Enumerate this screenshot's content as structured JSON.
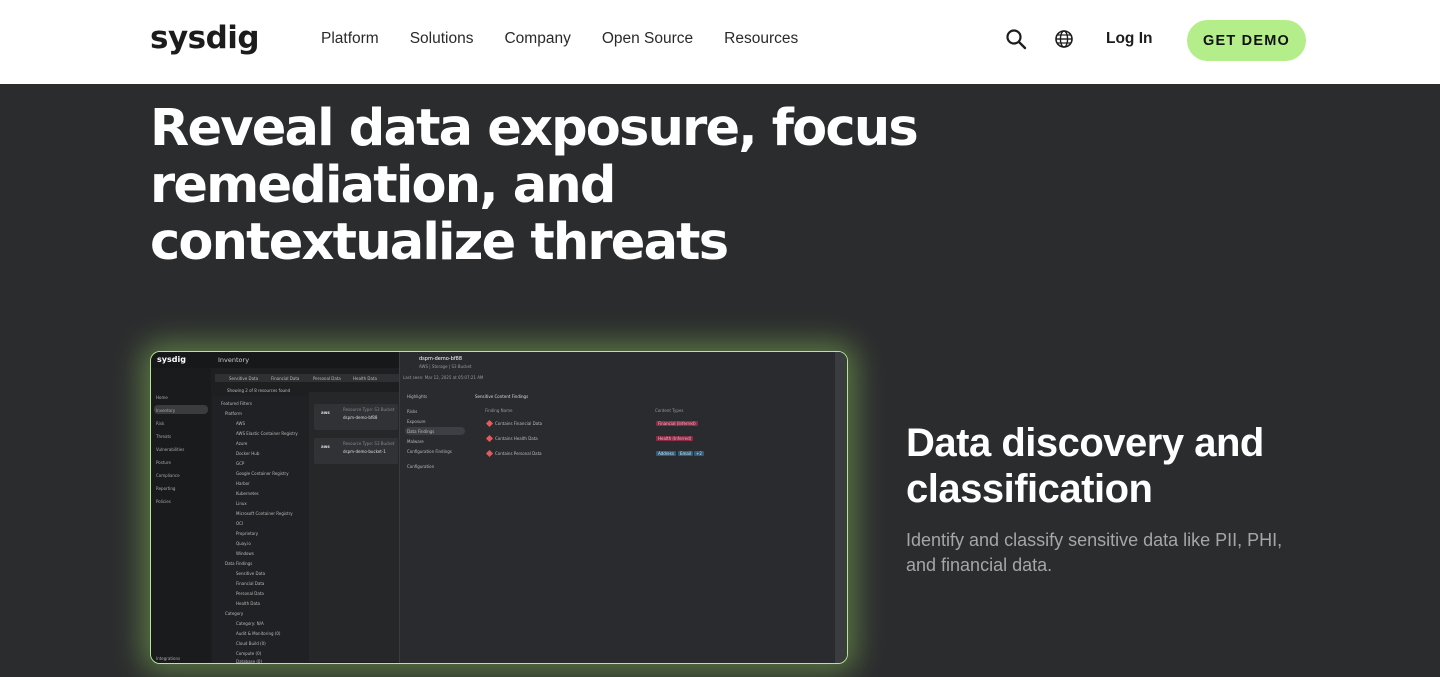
{
  "nav": {
    "logo": "sysdig",
    "links": [
      "Platform",
      "Solutions",
      "Company",
      "Open Source",
      "Resources"
    ],
    "login_label": "Log In",
    "cta_label": "GET DEMO",
    "cta_color": "#b4ee8b"
  },
  "hero": {
    "title": "Reveal data exposure, focus remediation, and contextualize threats"
  },
  "feature": {
    "title": "Data discovery and classification",
    "description": "Identify and classify sensitive data like PII, PHI, and financial data."
  },
  "screenshot": {
    "logo": "sysdig",
    "section": "Inventory",
    "sidebar": [
      "Home",
      "Inventory",
      "Risk",
      "Threats",
      "Vulnerabilities",
      "Posture",
      "Compliance",
      "Reporting",
      "Policies",
      "Integrations"
    ],
    "filters": [
      "Sensitive Data",
      "Financial Data",
      "Personal Data",
      "Health Data"
    ],
    "showing": "Showing 2 of 8 resources found",
    "featured_filters": "Featured Filters",
    "platform_group": "Platform",
    "platforms": [
      "AWS",
      "AWS Elastic Container Registry",
      "Azure",
      "Docker Hub",
      "GCP",
      "Google Container Registry",
      "Harbor",
      "Kubernetes",
      "Linux",
      "Microsoft Container Registry",
      "OCI",
      "Proprietary",
      "Quay.io",
      "Windows"
    ],
    "data_findings_group": "Data Findings",
    "data_findings": [
      "Sensitive Data",
      "Financial Data",
      "Personal Data",
      "Health Data"
    ],
    "category_group": "Category",
    "categories": [
      "Category: N/A",
      "Audit & Monitoring (0)",
      "Cloud Build (0)",
      "Compute (0)",
      "Database (0)"
    ],
    "resources": [
      {
        "type": "Resource Type: S3 Bucket",
        "name": "dspm-demo-bf88"
      },
      {
        "type": "Resource Type: S3 Bucket",
        "name": "dspm-demo-bucket-1"
      }
    ],
    "detail": {
      "title": "dspm-demo-bf88",
      "meta": "AWS | Storage | S3 Bucket",
      "last_seen": "Last seen: Mar 12, 2025 at 05:07:21 AM",
      "nav": [
        "Highlights",
        "Risks",
        "Exposure",
        "Data Findings",
        "Malware",
        "Configuration Findings",
        "Configuration"
      ],
      "section": "Sensitive Content Findings",
      "col_finding": "Finding Name",
      "col_types": "Content Types",
      "rows": [
        {
          "name": "Contains Financial Data",
          "tags": [
            "Financial (Inferred)"
          ]
        },
        {
          "name": "Contains Health Data",
          "tags": [
            "Health (Inferred)"
          ]
        },
        {
          "name": "Contains Personal Data",
          "tags": [
            "Address",
            "Email",
            "+2"
          ]
        }
      ]
    }
  }
}
